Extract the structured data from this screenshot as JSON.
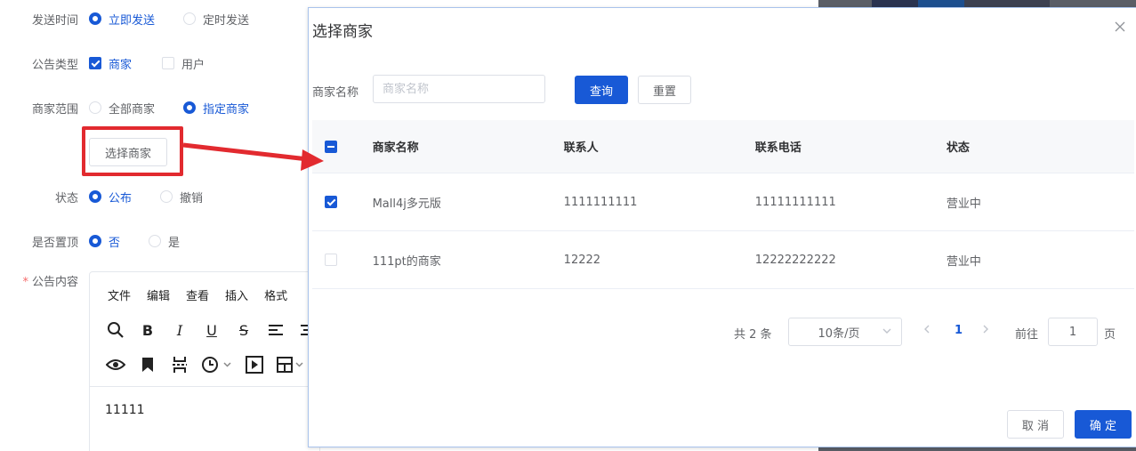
{
  "form": {
    "send_time": {
      "label": "发送时间",
      "options": [
        "立即发送",
        "定时发送"
      ],
      "selected": "立即发送"
    },
    "notice_type": {
      "label": "公告类型",
      "options": [
        "商家",
        "用户"
      ],
      "checked": [
        "商家"
      ]
    },
    "merchant_scope": {
      "label": "商家范围",
      "options": [
        "全部商家",
        "指定商家"
      ],
      "selected": "指定商家"
    },
    "select_merchant_button": "选择商家",
    "status": {
      "label": "状态",
      "options": [
        "公布",
        "撤销"
      ],
      "selected": "公布"
    },
    "pin_top": {
      "label": "是否置顶",
      "options": [
        "否",
        "是"
      ],
      "selected": "否"
    },
    "content": {
      "label": "公告内容",
      "required_mark": "*"
    }
  },
  "editor": {
    "menus": [
      "文件",
      "编辑",
      "查看",
      "插入",
      "格式"
    ],
    "toolbar_row1": [
      "search-icon",
      "bold-icon",
      "italic-icon",
      "underline-icon",
      "strikethrough-icon",
      "align-left-icon",
      "align-center-icon"
    ],
    "toolbar_row2": [
      "preview-icon",
      "bookmark-icon",
      "page-break-icon",
      "time-icon",
      "media-icon",
      "table-icon"
    ],
    "body_text": "11111"
  },
  "dialog": {
    "title": "选择商家",
    "search": {
      "label": "商家名称",
      "placeholder": "商家名称",
      "value": ""
    },
    "query_button": "查询",
    "reset_button": "重置",
    "columns": [
      "商家名称",
      "联系人",
      "联系电话",
      "状态"
    ],
    "header_checkbox": "indeterminate",
    "rows": [
      {
        "checked": true,
        "name": "Mall4j多元版",
        "contact": "1111111111",
        "phone": "11111111111",
        "status": "营业中"
      },
      {
        "checked": false,
        "name": "111pt的商家",
        "contact": "12222",
        "phone": "12222222222",
        "status": "营业中"
      }
    ],
    "pagination": {
      "total": "共 2 条",
      "page_size": "10条/页",
      "current_page": "1",
      "goto_label": "前往",
      "goto_value": "1",
      "page_suffix": "页"
    },
    "cancel_button": "取 消",
    "confirm_button": "确 定"
  },
  "colors": {
    "primary": "#1859d6",
    "annotation": "#e22a2f"
  }
}
